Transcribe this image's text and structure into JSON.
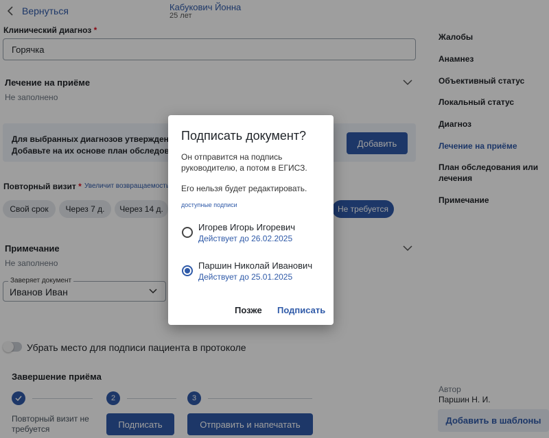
{
  "header": {
    "back_label": "Вернуться",
    "patient_name": "Кабукович Йонна",
    "patient_age": "25 лет"
  },
  "diagnosis": {
    "label": "Клинический диагноз",
    "required_mark": "*",
    "value": "Горячка"
  },
  "treatment": {
    "title": "Лечение на приёме",
    "status": "Не заполнено"
  },
  "banner": {
    "line1": "Для выбранных диагнозов утверждены",
    "line2": "Добавьте на их основе план обследован",
    "add_button": "Добавить"
  },
  "repeat_visit": {
    "title": "Повторный визит",
    "required_mark": "*",
    "hint": "Увеличит возвращаемость",
    "chips": [
      "Свой срок",
      "Через 7 д.",
      "Через 14 д.",
      "Не требуется"
    ]
  },
  "note": {
    "title": "Примечание",
    "status": "Не заполнено"
  },
  "certifier": {
    "label": "Заверяет документ",
    "value": "Иванов Иван"
  },
  "toggle_label": "Убрать место для подписи пациента в протоколе",
  "completion": {
    "title": "Завершение приёма",
    "steps": [
      "",
      "2",
      "3"
    ],
    "step1_text_line1": "Повторный визит не",
    "step1_text_line2": "требуется",
    "sign_button": "Подписать",
    "send_print_button": "Отправить и напечатать"
  },
  "sidebar": {
    "items": [
      {
        "label": "Жалобы"
      },
      {
        "label": "Анамнез"
      },
      {
        "label": "Объективный статус"
      },
      {
        "label": "Локальный статус"
      },
      {
        "label": "Диагноз"
      },
      {
        "label": "Лечение на приёме"
      },
      {
        "label": "План обследования или лечения"
      },
      {
        "label": "Примечание"
      }
    ],
    "active_index": 5,
    "author_label": "Автор",
    "author_name": "Паршин Н. И.",
    "template_button": "Добавить в шаблоны"
  },
  "dialog": {
    "title": "Подписать документ?",
    "text_line1": "Он отправится на подпись",
    "text_line2": "руководителю, а потом в ЕГИСЗ.",
    "text_note": "Его нельзя будет редактировать.",
    "caption": "доступные подписи",
    "signatures": [
      {
        "name": "Игорев Игорь Игоревич",
        "valid": "Действует до 26.02.2025",
        "selected": false
      },
      {
        "name": "Паршин Николай Иванович",
        "valid": "Действует до 25.01.2025",
        "selected": true
      }
    ],
    "later_button": "Позже",
    "sign_button": "Подписать"
  },
  "colors": {
    "accent": "#2f5aa8",
    "overlay": "#000000"
  }
}
